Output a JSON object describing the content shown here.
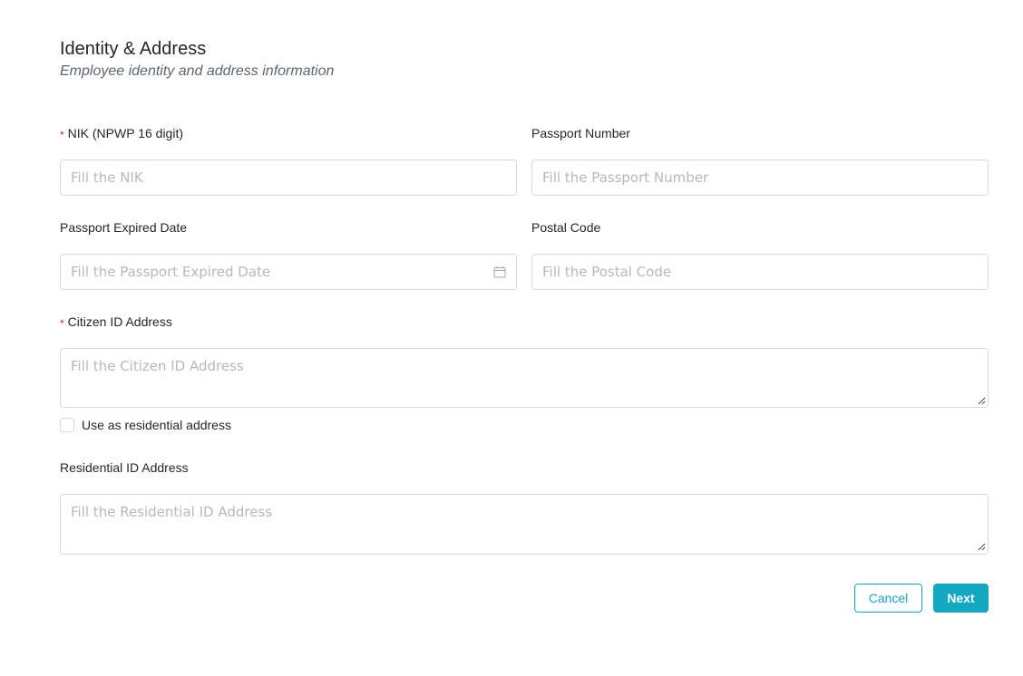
{
  "header": {
    "title": "Identity & Address",
    "subtitle": "Employee identity and address information"
  },
  "form": {
    "required_mark": "*",
    "nik": {
      "label": "NIK (NPWP 16 digit)",
      "placeholder": "Fill the NIK",
      "value": ""
    },
    "passport_number": {
      "label": "Passport Number",
      "placeholder": "Fill the Passport Number",
      "value": ""
    },
    "passport_expired_date": {
      "label": "Passport Expired Date",
      "placeholder": "Fill the Passport Expired Date",
      "value": "",
      "icon": "calendar-icon"
    },
    "postal_code": {
      "label": "Postal Code",
      "placeholder": "Fill the Postal Code",
      "value": ""
    },
    "citizen_id_address": {
      "label": "Citizen ID Address",
      "placeholder": "Fill the Citizen ID Address",
      "value": ""
    },
    "use_as_residential": {
      "label": "Use as residential address",
      "checked": false
    },
    "residential_id_address": {
      "label": "Residential ID Address",
      "placeholder": "Fill the Residential ID Address",
      "value": ""
    }
  },
  "actions": {
    "cancel_label": "Cancel",
    "next_label": "Next"
  },
  "colors": {
    "accent": "#13a8c2",
    "required": "#c41d7f",
    "border": "#d9d9d9",
    "placeholder": "#b8b8b8"
  }
}
